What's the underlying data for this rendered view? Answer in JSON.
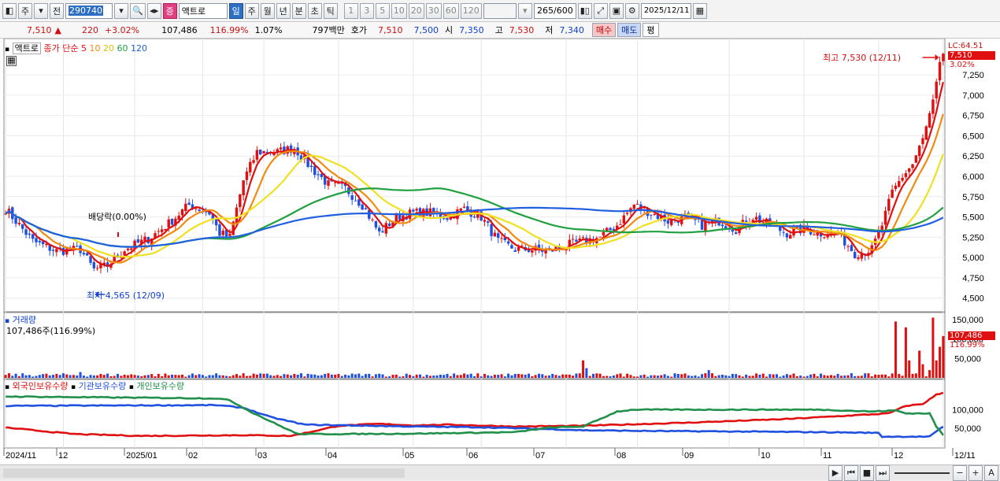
{
  "toolbar": {
    "period_jo": "주",
    "prev_label": "전",
    "code": "290740",
    "stock_tag": "증",
    "stock_name": "액트로",
    "periods": [
      "일",
      "주",
      "월",
      "년",
      "분",
      "초",
      "틱"
    ],
    "selected_period": "일",
    "intervals": [
      "1",
      "3",
      "5",
      "10",
      "20",
      "30",
      "60",
      "120"
    ],
    "count": "265",
    "count_total": "/600",
    "date": "2025/12/11"
  },
  "quote": {
    "price": "7,510",
    "arrow": "▲",
    "change": "220",
    "change_pct": "+3.02%",
    "volume": "107,486",
    "vol_ratio": "116.99%",
    "turnover": "1.07%",
    "amount": "797백만",
    "hoga_label": "호가",
    "hoga1": "7,510",
    "hoga2": "7,500",
    "open_label": "시",
    "open": "7,350",
    "high_label": "고",
    "high": "7,530",
    "low_label": "저",
    "low": "7,340",
    "buy": "매수",
    "sell": "매도",
    "flat": "평"
  },
  "price_panel": {
    "name": "액트로",
    "ma_label": "종가 단순",
    "ma_periods": [
      "5",
      "10",
      "20",
      "60",
      "120"
    ],
    "ma_colors": [
      "#e01010",
      "#f08a10",
      "#f0e020",
      "#20a040",
      "#2060e0"
    ],
    "high_note": "최고 7,530 (12/11)",
    "low_note": "최저 4,565 (12/09)",
    "div_note": "배당락(0.00%)",
    "lc_label": "LC:64.51",
    "last_label": "7,510",
    "last_pct": "3.02%"
  },
  "volume_panel": {
    "title": "거래량",
    "value": "107,486주(116.99%)",
    "last_label": "107,486",
    "last_pct": "116.99%"
  },
  "holder_panel": {
    "s1": "외국인보유수량",
    "s2": "기관보유수량",
    "s3": "개인보유수량"
  },
  "x_labels": [
    "2024/11",
    "12",
    "2025/01",
    "02",
    "03",
    "04",
    "05",
    "06",
    "07",
    "08",
    "09",
    "10",
    "11",
    "12",
    "12/11"
  ],
  "chart_data": [
    {
      "type": "candlestick",
      "title": "액트로",
      "ylim": [
        4400,
        7600
      ],
      "yticks": [
        4500,
        4750,
        5000,
        5250,
        5500,
        5750,
        6000,
        6250,
        6500,
        6750,
        7000,
        7250
      ],
      "anchors": [
        [
          0,
          5600
        ],
        [
          8,
          5200
        ],
        [
          15,
          5080
        ],
        [
          22,
          5100
        ],
        [
          26,
          4850
        ],
        [
          30,
          4900
        ],
        [
          35,
          5100
        ],
        [
          42,
          5230
        ],
        [
          48,
          5420
        ],
        [
          54,
          5650
        ],
        [
          60,
          5550
        ],
        [
          63,
          5300
        ],
        [
          66,
          5250
        ],
        [
          70,
          5950
        ],
        [
          74,
          6300
        ],
        [
          80,
          6300
        ],
        [
          85,
          6350
        ],
        [
          90,
          6100
        ],
        [
          95,
          5900
        ],
        [
          100,
          5850
        ],
        [
          105,
          5650
        ],
        [
          110,
          5300
        ],
        [
          115,
          5500
        ],
        [
          120,
          5550
        ],
        [
          125,
          5550
        ],
        [
          130,
          5500
        ],
        [
          135,
          5600
        ],
        [
          140,
          5500
        ],
        [
          145,
          5200
        ],
        [
          150,
          5100
        ],
        [
          155,
          5100
        ],
        [
          160,
          5080
        ],
        [
          165,
          5150
        ],
        [
          170,
          5200
        ],
        [
          175,
          5250
        ],
        [
          180,
          5400
        ],
        [
          185,
          5650
        ],
        [
          190,
          5550
        ],
        [
          195,
          5450
        ],
        [
          200,
          5500
        ],
        [
          205,
          5400
        ],
        [
          210,
          5450
        ],
        [
          215,
          5350
        ],
        [
          220,
          5500
        ],
        [
          225,
          5400
        ],
        [
          230,
          5300
        ],
        [
          235,
          5350
        ],
        [
          240,
          5300
        ],
        [
          245,
          5300
        ],
        [
          250,
          5050
        ],
        [
          255,
          5100
        ],
        [
          258,
          5400
        ],
        [
          261,
          5800
        ],
        [
          264,
          6000
        ],
        [
          267,
          6150
        ],
        [
          270,
          6450
        ],
        [
          273,
          6900
        ],
        [
          275,
          7350
        ],
        [
          276,
          7510
        ]
      ],
      "last_close": 7510
    },
    {
      "type": "bar",
      "title": "거래량",
      "yticks": [
        50000,
        100000,
        150000
      ],
      "ylim": [
        0,
        160000
      ],
      "spikes": [
        [
          22,
          15000
        ],
        [
          170,
          45000
        ],
        [
          171,
          25000
        ],
        [
          207,
          20000
        ],
        [
          249,
          12000
        ],
        [
          262,
          145000
        ],
        [
          265,
          130000
        ],
        [
          266,
          45000
        ],
        [
          269,
          70000
        ],
        [
          270,
          35000
        ],
        [
          272,
          20000
        ],
        [
          273,
          155000
        ],
        [
          274,
          45000
        ],
        [
          275,
          80000
        ],
        [
          276,
          107486
        ]
      ]
    },
    {
      "type": "line",
      "title": "보유수량",
      "yticks": [
        50000,
        100000
      ],
      "ylim": [
        0,
        170000
      ],
      "series": [
        {
          "name": "외국인보유수량",
          "color": "#e01010",
          "anchors": [
            [
              0,
              52000
            ],
            [
              20,
              35000
            ],
            [
              40,
              30000
            ],
            [
              70,
              32000
            ],
            [
              84,
              30000
            ],
            [
              92,
              45000
            ],
            [
              98,
              57000
            ],
            [
              110,
              62000
            ],
            [
              120,
              58000
            ],
            [
              130,
              60000
            ],
            [
              150,
              55000
            ],
            [
              170,
              57000
            ],
            [
              200,
              65000
            ],
            [
              230,
              75000
            ],
            [
              250,
              85000
            ],
            [
              260,
              90000
            ],
            [
              265,
              110000
            ],
            [
              270,
              115000
            ],
            [
              274,
              140000
            ],
            [
              276,
              145000
            ]
          ]
        },
        {
          "name": "기관보유수량",
          "color": "#2050e0",
          "anchors": [
            [
              0,
              110000
            ],
            [
              62,
              112000
            ],
            [
              70,
              105000
            ],
            [
              78,
              80000
            ],
            [
              88,
              60000
            ],
            [
              120,
              55000
            ],
            [
              140,
              53000
            ],
            [
              160,
              48000
            ],
            [
              170,
              45000
            ],
            [
              190,
              43000
            ],
            [
              210,
              42000
            ],
            [
              240,
              40000
            ],
            [
              257,
              38000
            ],
            [
              258,
              28000
            ],
            [
              272,
              28000
            ],
            [
              276,
              55000
            ]
          ]
        },
        {
          "name": "개인보유수량",
          "color": "#20904a",
          "anchors": [
            [
              0,
              135000
            ],
            [
              62,
              130000
            ],
            [
              66,
              125000
            ],
            [
              72,
              95000
            ],
            [
              80,
              60000
            ],
            [
              86,
              35000
            ],
            [
              100,
              35000
            ],
            [
              120,
              36000
            ],
            [
              150,
              40000
            ],
            [
              160,
              52000
            ],
            [
              170,
              55000
            ],
            [
              180,
              95000
            ],
            [
              185,
              100000
            ],
            [
              240,
              100000
            ],
            [
              255,
              95000
            ],
            [
              262,
              98000
            ],
            [
              265,
              90000
            ],
            [
              272,
              90000
            ],
            [
              274,
              55000
            ],
            [
              276,
              32000
            ]
          ]
        }
      ]
    }
  ]
}
